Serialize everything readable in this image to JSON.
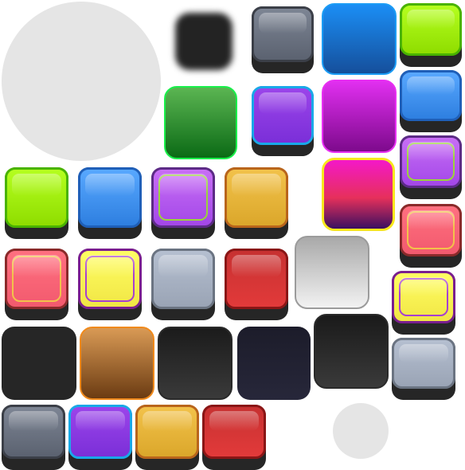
{
  "sheet": {
    "description_label": "",
    "colors": {
      "lime": "#a3f51a",
      "blue": "#4196ef",
      "violet": "#b55bef",
      "orange": "#e4b73a",
      "red": "#f65f73",
      "yellow": "#f8f052",
      "steel": "#a3aec0",
      "crimson": "#d23636",
      "slate": "#6a707d",
      "purple": "#8a39e0",
      "dark": "#262626",
      "light_gray": "#e5e5e5"
    }
  }
}
